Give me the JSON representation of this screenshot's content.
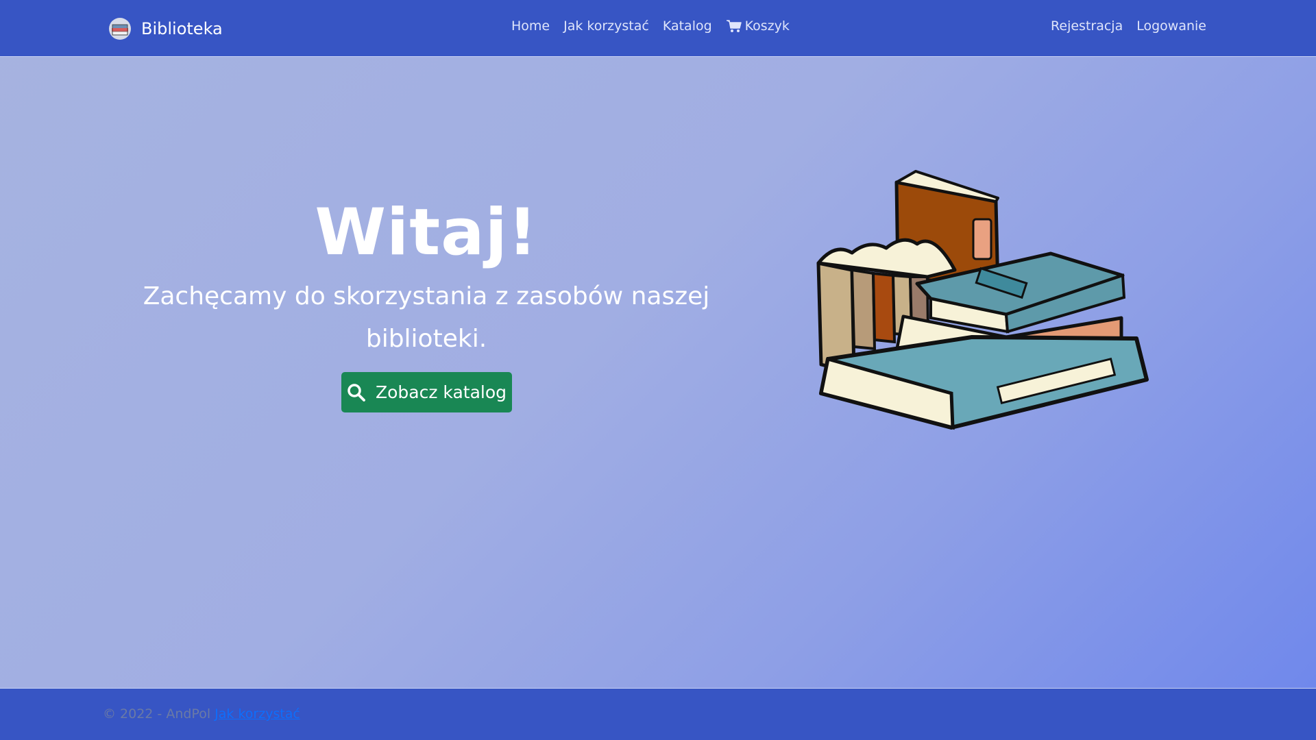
{
  "nav": {
    "brand": "Biblioteka",
    "links": [
      "Home",
      "Jak korzystać",
      "Katalog",
      "Koszyk"
    ],
    "cart_icon": "cart-icon",
    "right_links": [
      "Rejestracja",
      "Logowanie"
    ]
  },
  "hero": {
    "title": "Witaj!",
    "subtitle": "Zachęcamy do skorzystania z zasobów naszej biblioteki.",
    "cta_label": "Zobacz katalog",
    "cta_icon": "search-icon",
    "illustration": "books-illustration"
  },
  "footer": {
    "copyright": "© 2022 - AndPol",
    "link": "Jak korzystać"
  },
  "colors": {
    "navbar": "#3755c4",
    "cta": "#198754",
    "link": "#0d6efd"
  }
}
